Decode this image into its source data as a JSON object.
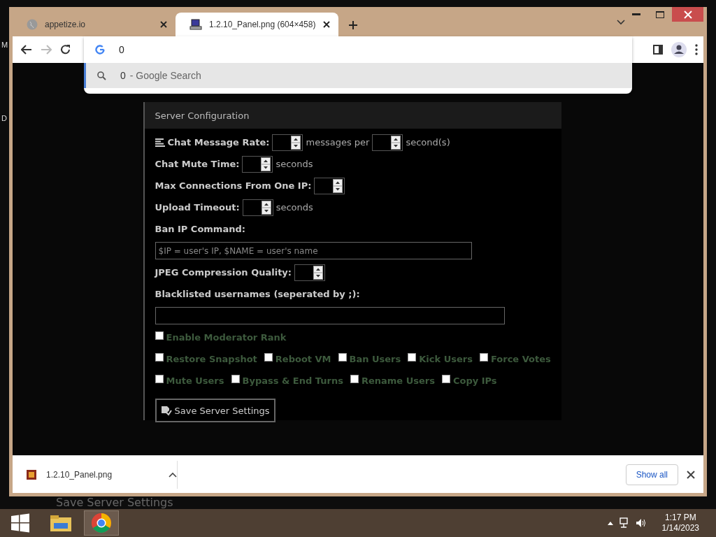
{
  "desktop": {
    "edge_letters": [
      "M",
      "D"
    ],
    "background_text": "Save Server Settings"
  },
  "browser": {
    "tabs": [
      {
        "title": "appetize.io",
        "selected": false
      },
      {
        "title": "1.2.10_Panel.png (604×458)",
        "selected": true
      }
    ],
    "omnibox": {
      "value": "0",
      "suggestion_query": "0",
      "suggestion_text": "- Google Search"
    }
  },
  "panel": {
    "title": "Server Configuration",
    "rows": [
      [
        {
          "kind": "label",
          "text": "Chat Message Rate:"
        },
        {
          "kind": "number"
        },
        {
          "kind": "unit",
          "text": "messages per"
        },
        {
          "kind": "number"
        },
        {
          "kind": "unit",
          "text": "second(s)"
        }
      ],
      [
        {
          "kind": "label",
          "text": "Chat Mute Time:"
        },
        {
          "kind": "number"
        },
        {
          "kind": "unit",
          "text": "seconds"
        }
      ],
      [
        {
          "kind": "label",
          "text": "Max Connections From One IP:"
        },
        {
          "kind": "number"
        }
      ],
      [
        {
          "kind": "label",
          "text": "Upload Timeout:"
        },
        {
          "kind": "number"
        },
        {
          "kind": "unit",
          "text": "seconds"
        }
      ],
      [
        {
          "kind": "label",
          "text": "Ban IP Command:"
        }
      ],
      [
        {
          "kind": "text",
          "placeholder": "$IP = user's IP, $NAME = user's name"
        }
      ],
      [
        {
          "kind": "label",
          "text": "JPEG Compression Quality:"
        },
        {
          "kind": "number"
        }
      ],
      [
        {
          "kind": "label",
          "text": "Blacklisted usernames (seperated by ;):"
        }
      ],
      [
        {
          "kind": "text"
        }
      ],
      [
        {
          "kind": "checkbox",
          "label": "Enable Moderator Rank",
          "checked": false
        }
      ],
      [
        {
          "kind": "checkbox",
          "label": "Restore Snapshot",
          "checked": false
        },
        {
          "kind": "checkbox",
          "label": "Reboot VM",
          "checked": false
        },
        {
          "kind": "checkbox",
          "label": "Ban Users",
          "checked": false
        },
        {
          "kind": "checkbox",
          "label": "Kick Users",
          "checked": false
        },
        {
          "kind": "checkbox",
          "label": "Force Votes",
          "checked": false
        }
      ],
      [
        {
          "kind": "checkbox",
          "label": "Mute Users",
          "checked": false
        },
        {
          "kind": "checkbox",
          "label": "Bypass & End Turns",
          "checked": false
        },
        {
          "kind": "checkbox",
          "label": "Rename Users",
          "checked": false
        },
        {
          "kind": "checkbox",
          "label": "Copy IPs",
          "checked": false
        }
      ]
    ],
    "save_button": "Save Server Settings"
  },
  "download_bar": {
    "file": "1.2.10_Panel.png",
    "button": "Show all"
  },
  "taskbar": {
    "time": "1:17 PM",
    "date": "1/14/2023"
  }
}
